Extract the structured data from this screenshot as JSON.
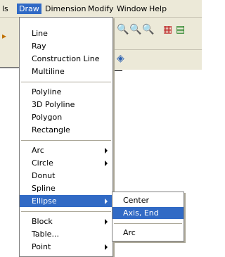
{
  "menubar": {
    "items": [
      {
        "label": "ls"
      },
      {
        "label": "Draw"
      },
      {
        "label": "Dimension"
      },
      {
        "label": "Modify"
      },
      {
        "label": "Window"
      },
      {
        "label": "Help"
      }
    ]
  },
  "draw_menu": {
    "items": [
      {
        "label": "Line"
      },
      {
        "label": "Ray"
      },
      {
        "label": "Construction Line"
      },
      {
        "label": "Multiline"
      },
      {
        "label": "Polyline"
      },
      {
        "label": "3D Polyline"
      },
      {
        "label": "Polygon"
      },
      {
        "label": "Rectangle"
      },
      {
        "label": "Arc"
      },
      {
        "label": "Circle"
      },
      {
        "label": "Donut"
      },
      {
        "label": "Spline"
      },
      {
        "label": "Ellipse"
      },
      {
        "label": "Block"
      },
      {
        "label": "Table..."
      },
      {
        "label": "Point"
      }
    ]
  },
  "ellipse_submenu": {
    "items": [
      {
        "label": "Center"
      },
      {
        "label": "Axis, End"
      },
      {
        "label": "Arc"
      }
    ]
  },
  "toolbar": {
    "icons": [
      "zoom-realtime-icon",
      "zoom-window-icon",
      "zoom-previous-icon",
      "properties-icon",
      "design-center-icon",
      "tool-palette-icon"
    ]
  },
  "colors": {
    "highlight": "#316ac5",
    "menubar_bg": "#ece9d8"
  }
}
